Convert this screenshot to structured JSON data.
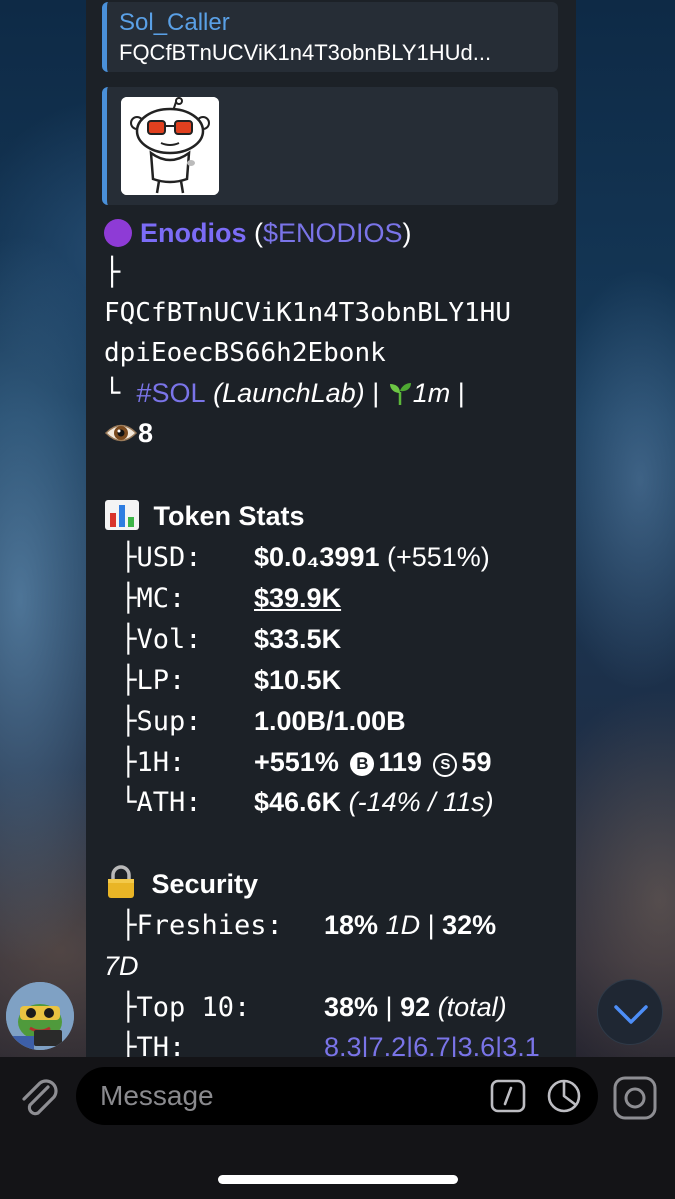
{
  "reply": {
    "sender": "Sol_Caller",
    "preview": "FQCfBTnUCViK1n4T3obnBLY1HUd..."
  },
  "token": {
    "name": "Enodios",
    "paren_open": " (",
    "ticker": "$ENODIOS",
    "paren_close": ")",
    "tree1": " ├",
    "address_line1": "FQCfBTnUCViK1n4T3obnBLY1HU",
    "address_line2": "dpiEoecBS66h2Ebonk",
    "tree2": " └ ",
    "chain": "#SOL",
    "launchpad": " (LaunchLab)",
    "sep1": " | ",
    "age": "1m",
    "sep2": " |",
    "views": "8"
  },
  "stats": {
    "heading": "Token Stats",
    "rows": [
      {
        "prefix": "├",
        "label": "USD:",
        "value": "$0.0₄3991",
        "extra": " (+551%)"
      },
      {
        "prefix": "├",
        "label": "MC:",
        "value": "$39.9K"
      },
      {
        "prefix": "├",
        "label": "Vol:",
        "value": "$33.5K"
      },
      {
        "prefix": "├",
        "label": "LP:",
        "value": "$10.5K"
      },
      {
        "prefix": "├",
        "label": "Sup:",
        "value": "1.00B/1.00B"
      },
      {
        "prefix": "├",
        "label": "1H:",
        "value": "+551%",
        "buys_icon": "B",
        "buys": "119",
        "sells_icon": "S",
        "sells": "59"
      },
      {
        "prefix": "└",
        "label": "ATH:",
        "value": "$46.6K",
        "extra": " (-14% / 11s)"
      }
    ]
  },
  "security": {
    "heading": "Security",
    "freshies_label": "Freshies:",
    "freshies_1d": "18%",
    "freshies_1d_unit": " 1D",
    "sep": " | ",
    "freshies_7d": "32%",
    "freshies_7d_unit": "7D",
    "top10_label": "Top 10:",
    "top10_pct": "38%",
    "top10_total": "92",
    "top10_total_label": " (total)",
    "th_label": "TH:",
    "th_values": "8.3|7.2|6.7|3.6|3.1"
  },
  "composer": {
    "placeholder": "Message"
  },
  "icons": {
    "attach": "paperclip-icon",
    "commands": "slash-command-icon",
    "sticker": "sticker-icon",
    "camera": "camera-icon",
    "scroll_down": "chevron-down-icon",
    "status_dot": "purple-circle-icon",
    "views": "eye-icon",
    "seedling": "seedling-icon",
    "chart": "bar-chart-icon",
    "lock": "lock-icon"
  },
  "colors": {
    "accent_blue": "#5aa0e6",
    "link_purple": "#7a74e8",
    "bubble_bg": "#1c2127"
  }
}
